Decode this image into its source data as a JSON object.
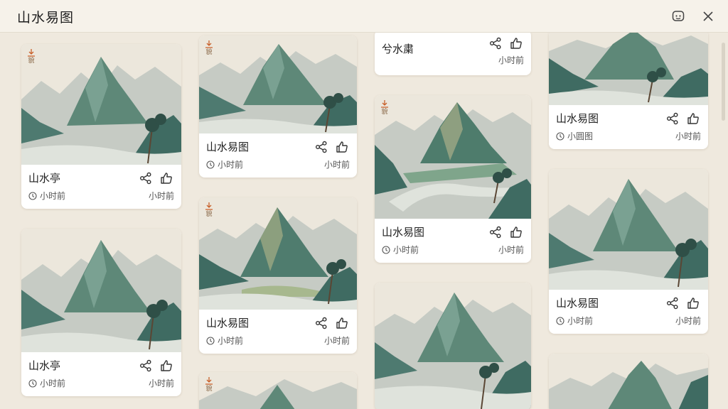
{
  "app": {
    "title": "山水易图"
  },
  "header": {
    "assistant_icon": "chat-bubble-icon",
    "close_icon": "close-icon"
  },
  "cards": [
    {
      "title": "山水亭",
      "time": "小时前",
      "time_right": "小时前",
      "badge": "貌"
    },
    {
      "title": "山水亭",
      "time": "小时前",
      "time_right": "小时前"
    },
    {
      "title": "山水易图",
      "time": "小时前",
      "time_right": "小时前",
      "badge": "貌"
    },
    {
      "title": "山水易图",
      "time": "小时前",
      "time_right": "小时前",
      "badge": "貌"
    },
    {
      "badge": "貌"
    },
    {
      "title": "兮水粛",
      "time_right": "小时前"
    },
    {
      "title": "山水易图",
      "time": "小时前",
      "time_right": "小时前",
      "badge": "貌"
    },
    {},
    {
      "title": "山水易图",
      "time": "小圆图",
      "time_right": "小时前"
    },
    {
      "title": "山水易图",
      "time": "小时前",
      "time_right": "小时前"
    },
    {}
  ],
  "icons": {
    "share": "share-icon",
    "like": "thumbs-up-icon",
    "clock": "clock-icon",
    "download": "download-icon"
  },
  "colors": {
    "background": "#efe9de",
    "card": "#ffffff",
    "accent": "#c8602a"
  }
}
